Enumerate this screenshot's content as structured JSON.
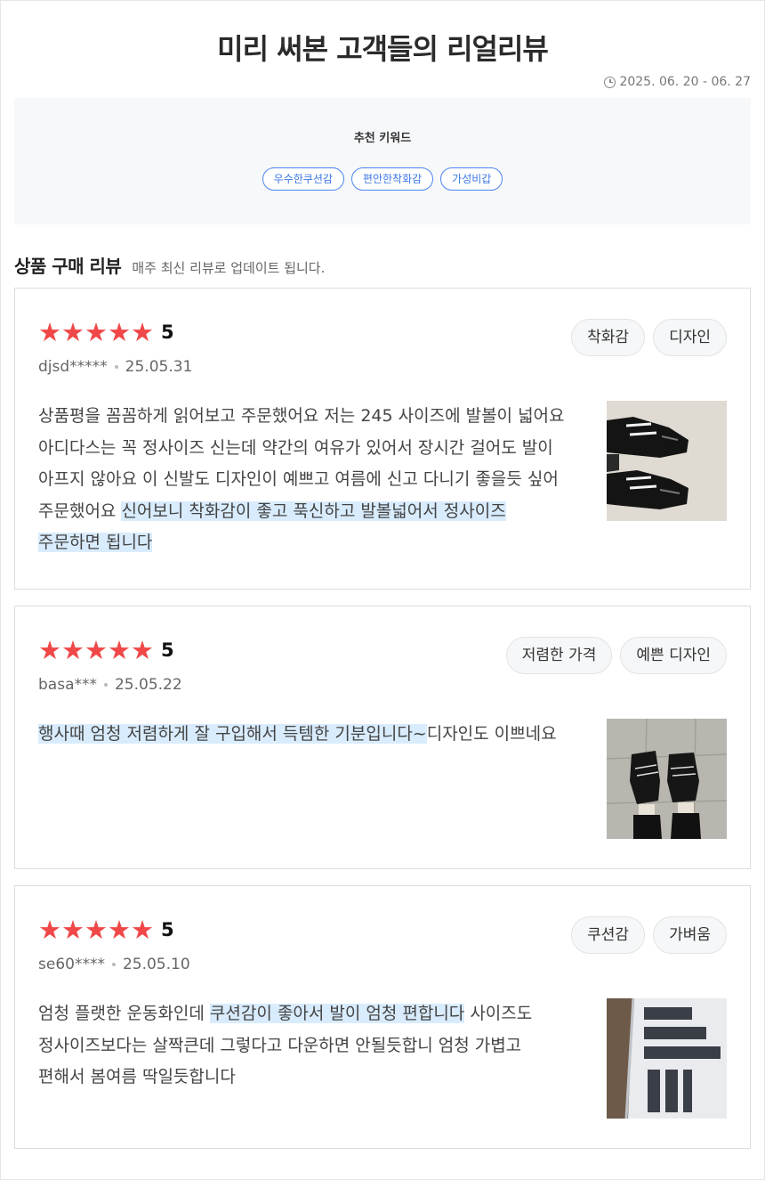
{
  "header": {
    "title": "미리 써본 고객들의 리얼리뷰",
    "date_range": "2025. 06. 20 - 06. 27"
  },
  "keywords": {
    "title": "추천 키워드",
    "items": [
      "우수한쿠션감",
      "편안한착화감",
      "가성비갑"
    ]
  },
  "section": {
    "title": "상품 구매 리뷰",
    "subtitle": "매주 최신 리뷰로 업데이트 됩니다."
  },
  "reviews": [
    {
      "rating": "5",
      "user": "djsd*****",
      "date": "25.05.31",
      "tags": [
        "착화감",
        "디자인"
      ],
      "text_plain": "상품평을 꼼꼼하게 읽어보고 주문했어요 저는 245 사이즈에 발볼이 넓어요 아디다스는 꼭 정사이즈 신는데 약간의 여유가 있어서 장시간 걸어도 발이 아프지 않아요 이 신발도 디자인이 예쁘고 여름에 신고 다니기 좋을듯 싶어 주문했어요 ",
      "text_highlight": "신어보니 착화감이 좋고 푹신하고 발볼넓어서 정사이즈 주문하면 됩니다",
      "text_after": ""
    },
    {
      "rating": "5",
      "user": "basa***",
      "date": "25.05.22",
      "tags": [
        "저렴한 가격",
        "예쁜 디자인"
      ],
      "text_plain": "",
      "text_highlight": "행사때 엄청 저렴하게 잘 구입해서 득템한 기분입니다~",
      "text_after": "디자인도 이쁘네요"
    },
    {
      "rating": "5",
      "user": "se60****",
      "date": "25.05.10",
      "tags": [
        "쿠션감",
        "가벼움"
      ],
      "text_plain": "엄청 플랫한 운동화인데 ",
      "text_highlight": "쿠션감이 좋아서 발이 엄청 편합니다",
      "text_after": " 사이즈도 정사이즈보다는 살짝큰데 그렇다고 다운하면 안될듯합니 엄청 가볍고 편해서 봄여름 딱일듯합니다"
    }
  ],
  "colors": {
    "star": "#f04848",
    "keyword_chip": "#3c78e6",
    "highlight": "#d9ecfd"
  }
}
